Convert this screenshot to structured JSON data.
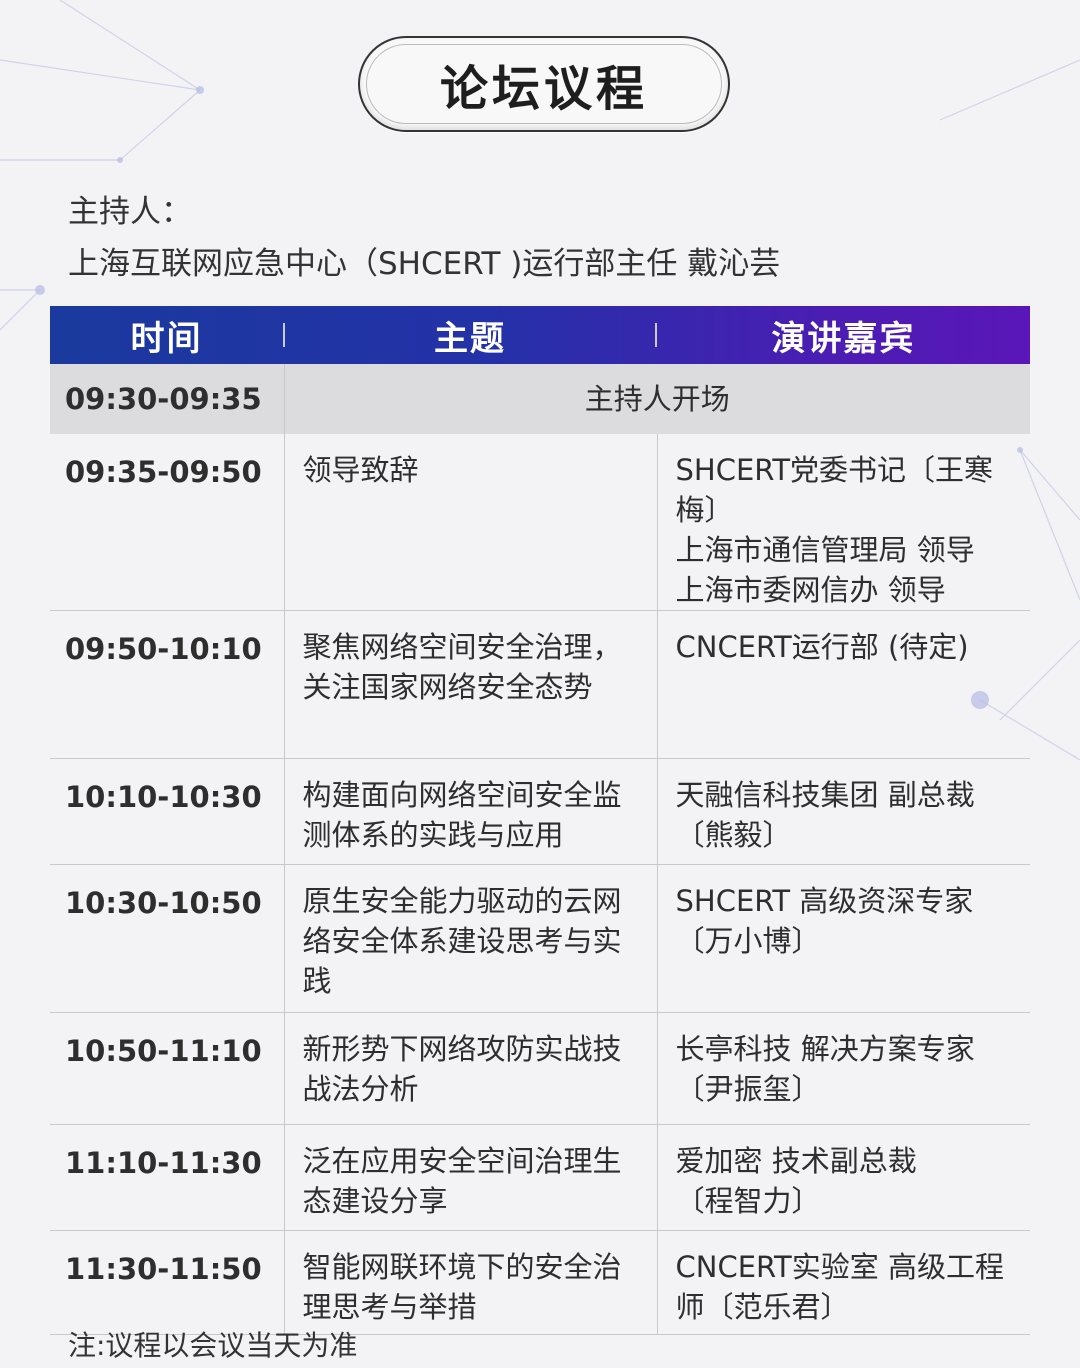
{
  "title": "论坛议程",
  "host": {
    "label": "主持人：",
    "name": "上海互联网应急中心（SHCERT )运行部主任  戴沁芸"
  },
  "header": {
    "time": "时间",
    "topic": "主题",
    "speaker": "演讲嘉宾"
  },
  "opening": {
    "time": "09:30-09:35",
    "text": "主持人开场"
  },
  "rows": [
    {
      "time": "09:35-09:50",
      "topic": "领导致辞",
      "speaker": "SHCERT党委书记〔王寒梅〕\n上海市通信管理局 领导\n上海市委网信办 领导"
    },
    {
      "time": "09:50-10:10",
      "topic": "聚焦网络空间安全治理，关注国家网络安全态势",
      "speaker": "CNCERT运行部 (待定)"
    },
    {
      "time": "10:10-10:30",
      "topic": "构建面向网络空间安全监测体系的实践与应用",
      "speaker": "天融信科技集团 副总裁\n〔熊毅〕"
    },
    {
      "time": "10:30-10:50",
      "topic": "原生安全能力驱动的云网络安全体系建设思考与实践",
      "speaker": "SHCERT 高级资深专家\n〔万小博〕"
    },
    {
      "time": "10:50-11:10",
      "topic": "新形势下网络攻防实战技战法分析",
      "speaker": "长亭科技 解决方案专家\n〔尹振玺〕"
    },
    {
      "time": "11:10-11:30",
      "topic": "泛在应用安全空间治理生态建设分享",
      "speaker": "爱加密 技术副总裁\n〔程智力〕"
    },
    {
      "time": "11:30-11:50",
      "topic": "智能网联环境下的安全治理思考与举措",
      "speaker": "CNCERT实验室 高级工程师〔范乐君〕"
    }
  ],
  "note": "注:议程以会议当天为准"
}
